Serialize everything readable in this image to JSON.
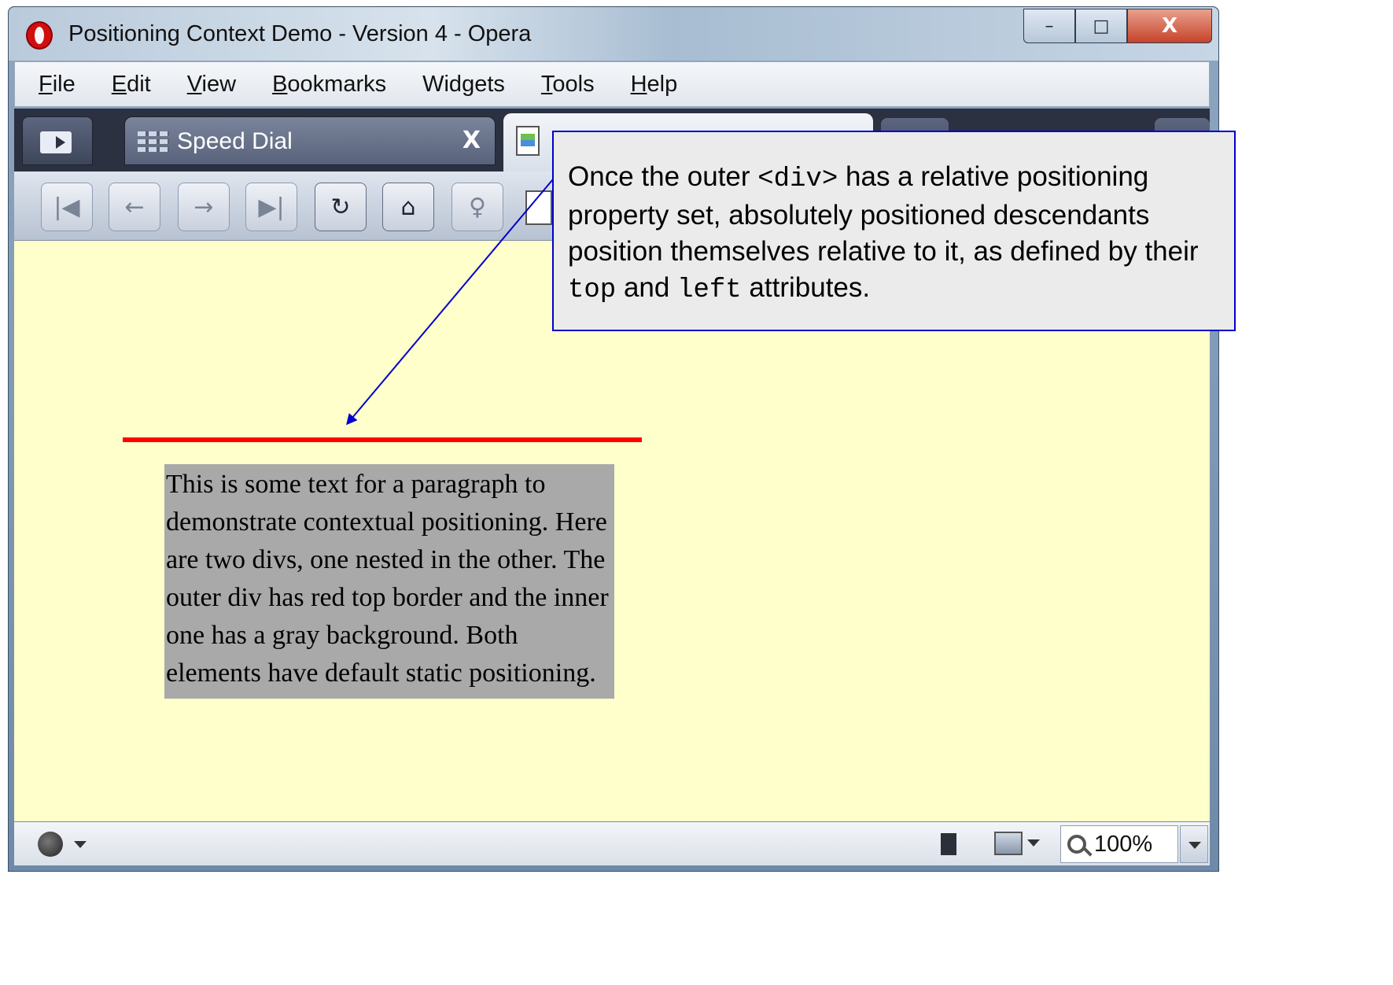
{
  "window": {
    "title": "Positioning Context Demo - Version 4 - Opera",
    "minimize_glyph": "–",
    "maximize_glyph": "□",
    "close_glyph": "X"
  },
  "menu": {
    "items": [
      {
        "label": "File",
        "accel": "F"
      },
      {
        "label": "Edit",
        "accel": "E"
      },
      {
        "label": "View",
        "accel": "V"
      },
      {
        "label": "Bookmarks",
        "accel": "B"
      },
      {
        "label": "Widgets",
        "accel": "g"
      },
      {
        "label": "Tools",
        "accel": "T"
      },
      {
        "label": "Help",
        "accel": "H"
      }
    ]
  },
  "tabs": {
    "speed_dial_label": "Speed Dial",
    "speed_dial_close": "X"
  },
  "nav": {
    "first": "|◀",
    "back": "←",
    "forward": "→",
    "last": "▶|",
    "reload": "↻",
    "home": "⌂",
    "wand": "♀"
  },
  "content": {
    "background": "#ffffcc",
    "outer_border_color": "#ff0000",
    "inner_background": "#a9a9a9",
    "paragraph": "This is some text for a paragraph to demonstrate contextual positioning. Here are two divs, one nested in the other. The outer div has red top border and the inner one has a gray background. Both elements have default static positioning."
  },
  "statusbar": {
    "zoom": "100%"
  },
  "callout": {
    "border_color": "#0000cc",
    "part1": "Once the outer ",
    "code1": "<div>",
    "part2": "  has a relative positioning property set, absolutely positioned descendants position themselves relative to it, as defined by their ",
    "code2": "top",
    "part3": " and ",
    "code3": "left",
    "part4": " attributes."
  }
}
